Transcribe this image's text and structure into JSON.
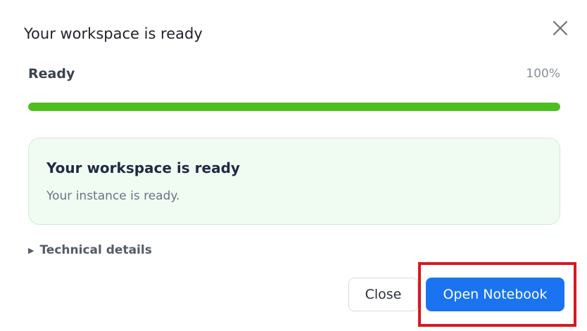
{
  "dialog": {
    "title": "Your workspace is ready",
    "close_icon": "close-icon"
  },
  "status": {
    "label": "Ready",
    "percent_text": "100%",
    "progress_fraction": 1.0,
    "progress_color": "#4cbf1f"
  },
  "card": {
    "title": "Your workspace is ready",
    "message": "Your instance is ready."
  },
  "details": {
    "label": "Technical details",
    "icon": "disclosure-triangle-icon",
    "expanded": false
  },
  "actions": {
    "close_label": "Close",
    "open_label": "Open Notebook",
    "primary_color": "#1a73f0",
    "highlight_color": "#d9181e"
  }
}
